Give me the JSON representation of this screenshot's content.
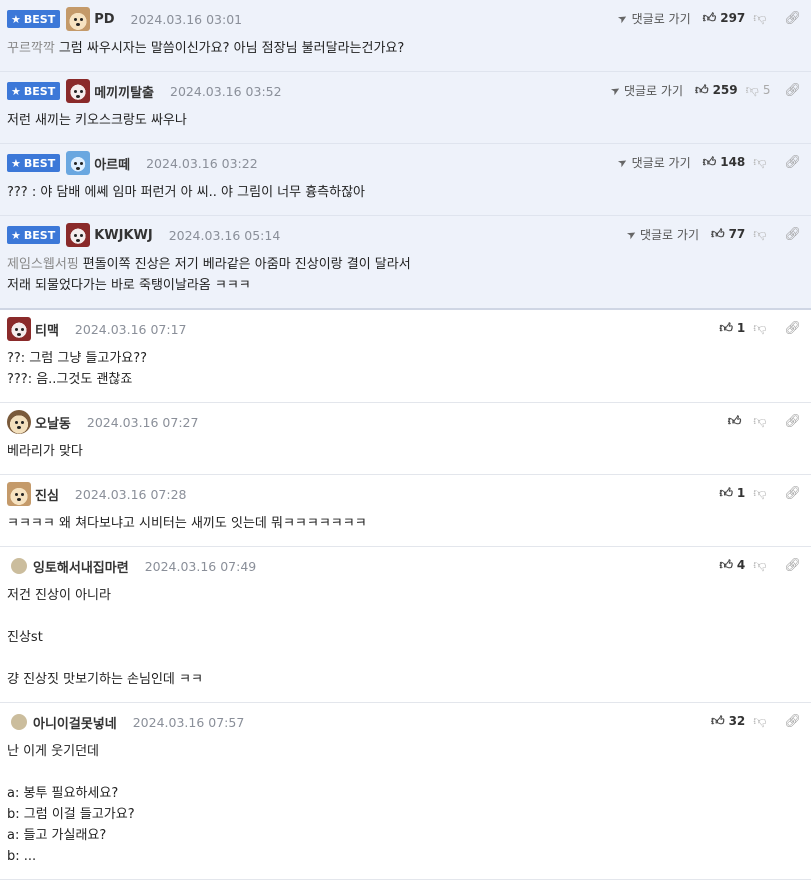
{
  "ui": {
    "best_label": "BEST",
    "reply_link_label": "댓글로 가기"
  },
  "comments": [
    {
      "best": true,
      "nick": "PD",
      "date": "2024.03.16 03:01",
      "likes": "297",
      "dislikes": "",
      "mention": "꾸르깍깍",
      "lines": [
        "그럼 싸우시자는 말씀이신가요? 아님 점장님 불러달라는건가요?"
      ]
    },
    {
      "best": true,
      "nick": "메끼끼탈출",
      "date": "2024.03.16 03:52",
      "likes": "259",
      "dislikes": "5",
      "mention": "",
      "lines": [
        "저런 새끼는 키오스크랑도 싸우나"
      ]
    },
    {
      "best": true,
      "nick": "아르떼",
      "date": "2024.03.16 03:22",
      "likes": "148",
      "dislikes": "",
      "mention": "",
      "lines": [
        "??? : 야 담배 에쎄 임마 퍼런거 아 씨.. 야 그림이 너무 흉측하잖아"
      ]
    },
    {
      "best": true,
      "nick": "KWJKWJ",
      "date": "2024.03.16 05:14",
      "likes": "77",
      "dislikes": "",
      "mention": "제임스웹서핑",
      "lines": [
        "편돌이쪽 진상은 저기 베라같은 아줌마 진상이랑 결이 달라서",
        "저래 되물었다가는 바로 죽탱이날라옴 ㅋㅋㅋ"
      ]
    },
    {
      "best": false,
      "nick": "티맥",
      "date": "2024.03.16 07:17",
      "likes": "1",
      "dislikes": "",
      "mention": "",
      "lines": [
        "??: 그럼 그냥 들고가요??",
        "???: 음..그것도 괜찮죠"
      ]
    },
    {
      "best": false,
      "nick": "오날동",
      "date": "2024.03.16 07:27",
      "likes": "",
      "dislikes": "",
      "mention": "",
      "lines": [
        "베라리가 맞다"
      ]
    },
    {
      "best": false,
      "nick": "진심",
      "date": "2024.03.16 07:28",
      "likes": "1",
      "dislikes": "",
      "mention": "",
      "lines": [
        "ㅋㅋㅋㅋ 왜 쳐다보냐고 시비터는 새끼도 잇는데 뭐ㅋㅋㅋㅋㅋㅋㅋ"
      ]
    },
    {
      "best": false,
      "nick": "잉토해서내집마련",
      "date": "2024.03.16 07:49",
      "likes": "4",
      "dislikes": "",
      "mention": "",
      "lines": [
        "저건 진상이 아니라",
        "",
        "진상st",
        "",
        "걍 진상짓 맛보기하는 손님인데 ㅋㅋ"
      ]
    },
    {
      "best": false,
      "nick": "아니이걸못넣네",
      "date": "2024.03.16 07:57",
      "likes": "32",
      "dislikes": "",
      "mention": "",
      "lines": [
        "난 이게 웃기던데",
        "",
        "a: 봉투 필요하세요?",
        "b: 그럼 이걸 들고가요?",
        "a: 들고 가실래요?",
        "b: ..."
      ]
    }
  ]
}
